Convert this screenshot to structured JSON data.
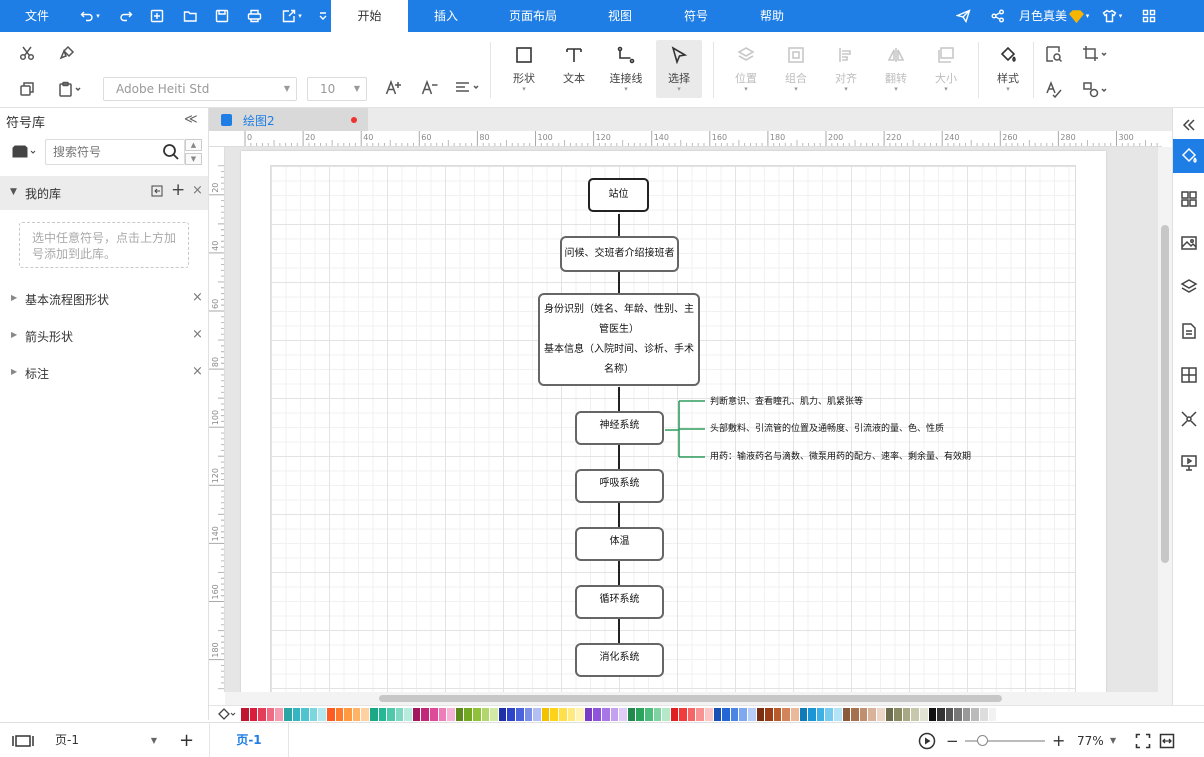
{
  "menubar": {
    "file": "文件",
    "tabs": [
      "开始",
      "插入",
      "页面布局",
      "视图",
      "符号",
      "帮助"
    ],
    "active_tab": "开始",
    "user": "月色真美"
  },
  "ribbon": {
    "font_family": "Adobe Heiti Std",
    "font_size": "10",
    "shape": "形状",
    "text": "文本",
    "connector": "连接线",
    "select": "选择",
    "position": "位置",
    "group": "组合",
    "align": "对齐",
    "flip": "翻转",
    "size": "大小",
    "style": "样式"
  },
  "left_panel": {
    "title": "符号库",
    "search_placeholder": "搜索符号",
    "my_library": "我的库",
    "hint": "选中任意符号，点击上方加号添加到此库。",
    "categories": [
      "基本流程图形状",
      "箭头形状",
      "标注"
    ]
  },
  "document": {
    "tab_name": "绘图2"
  },
  "rulers": {
    "h_labels": [
      "0",
      "20",
      "40",
      "60",
      "80",
      "100",
      "120",
      "140",
      "160",
      "180",
      "200",
      "220",
      "240",
      "260",
      "280",
      "300"
    ],
    "v_labels": [
      "20",
      "40",
      "60",
      "80",
      "100",
      "120",
      "140",
      "160",
      "180"
    ]
  },
  "diagram": {
    "nodes": [
      {
        "id": "n1",
        "text": "站位"
      },
      {
        "id": "n2",
        "text": "问候、交班者介绍接班者"
      },
      {
        "id": "n3",
        "lines": [
          "身份识别（姓名、年龄、性别、主",
          "管医生）",
          "基本信息（入院时间、诊析、手术",
          "名称）"
        ]
      },
      {
        "id": "n4",
        "text": "神经系统"
      },
      {
        "id": "n5",
        "text": "呼吸系统"
      },
      {
        "id": "n6",
        "text": "体温"
      },
      {
        "id": "n7",
        "text": "循环系统"
      },
      {
        "id": "n8",
        "text": "消化系统"
      }
    ],
    "notes": [
      "判断意识、查看瞳孔、肌力、肌紧张等",
      "头部敷料、引流管的位置及通畅度、引流液的量、色、性质",
      "用药：输液药名与滴数、微泵用药的配方、速率、剩余量、有效期"
    ],
    "line_color": "#222222",
    "brace_color": "#2e9e5e"
  },
  "palette": {
    "colors": [
      "#c0152f",
      "#d81e3c",
      "#e33d5a",
      "#ef6a82",
      "#f59bb0",
      "#2aa6a5",
      "#35b5c2",
      "#4fc4d0",
      "#7cd6de",
      "#b3e9ee",
      "#ff5a1f",
      "#ff7a2d",
      "#ff9a40",
      "#ffb366",
      "#ffd0a0",
      "#1aa886",
      "#25b896",
      "#4cc9aa",
      "#7fd9c2",
      "#b6ebdd",
      "#a3155c",
      "#c2277a",
      "#dd4b98",
      "#ec7db8",
      "#f6b3d6",
      "#5c8a1a",
      "#72a822",
      "#8fc23a",
      "#b0d66c",
      "#d3eaa6",
      "#1e2fa8",
      "#2b44c9",
      "#4a62dc",
      "#7b8fe8",
      "#b3bff3",
      "#f2c200",
      "#ffd21a",
      "#ffe04a",
      "#ffea80",
      "#fff3b6",
      "#7a3cc4",
      "#9053dc",
      "#a877e6",
      "#c3a1ef",
      "#dfcdf7",
      "#1f8a4c",
      "#2aa35d",
      "#4cbd7b",
      "#7fd3a0",
      "#b5e8c8",
      "#e02020",
      "#f03c3c",
      "#f56565",
      "#f99393",
      "#fcc4c4",
      "#1a4fb4",
      "#2466d6",
      "#4a85e6",
      "#7ea8ef",
      "#b5cdf7",
      "#7a2e10",
      "#9a3d16",
      "#b85a2a",
      "#d3845a",
      "#ebb899",
      "#0f7bb8",
      "#1a96d6",
      "#3db0e6",
      "#77cbef",
      "#b3e3f7",
      "#8a5a3c",
      "#a6714f",
      "#c08f6f",
      "#d8b29a",
      "#ecd6c7",
      "#6d6d4d",
      "#8a8a62",
      "#a8a884",
      "#c7c7ac",
      "#e3e3d4",
      "#111111",
      "#333333",
      "#555555",
      "#777777",
      "#999999",
      "#bbbbbb",
      "#dddddd",
      "#f2f2f2"
    ]
  },
  "statusbar": {
    "page_select": "页-1",
    "page_tab": "页-1",
    "zoom": "77%"
  },
  "colors": {
    "accent": "#1f7ee5"
  }
}
